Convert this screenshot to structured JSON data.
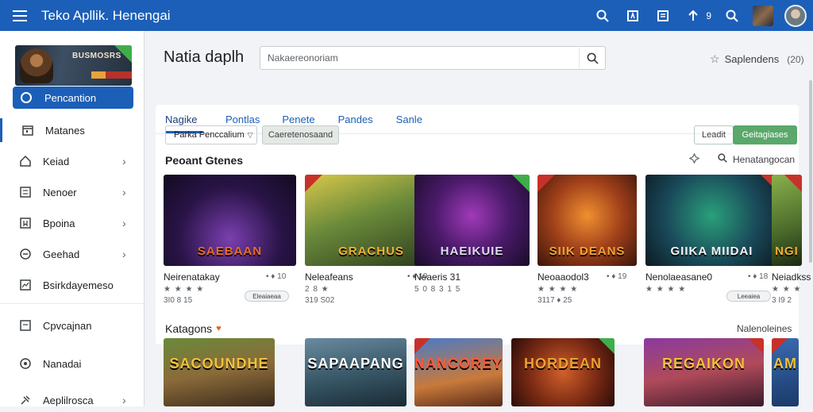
{
  "topbar": {
    "title": "Teko Apllik. Henengai",
    "count": "9",
    "icons": [
      "menu-icon",
      "search-icon",
      "store-icon",
      "news-icon",
      "upload-icon",
      "search-icon-2"
    ]
  },
  "sidebar": {
    "promo": {
      "text": "BUSMOSRS"
    },
    "primary": {
      "label": "Pencantion"
    },
    "items": [
      {
        "label": "Matanes",
        "icon": "calendar-icon",
        "chevron": false,
        "active": true
      },
      {
        "label": "Keiad",
        "icon": "home-icon",
        "chevron": true
      },
      {
        "label": "Nenoer",
        "icon": "image-icon",
        "chevron": true
      },
      {
        "label": "Bpoina",
        "icon": "bookmark-icon",
        "chevron": true
      },
      {
        "label": "Geehad",
        "icon": "compass-icon",
        "chevron": true
      },
      {
        "label": "Bsirkdayemeso",
        "icon": "chart-icon",
        "chevron": false
      },
      {
        "label": "Cpvcajnan",
        "icon": "document-icon",
        "chevron": false
      },
      {
        "label": "Nanadai",
        "icon": "pin-icon",
        "chevron": false
      },
      {
        "label": "Aeplilrosca",
        "icon": "puzzle-icon",
        "chevron": true
      }
    ]
  },
  "main": {
    "title": "Natia daplh",
    "search": {
      "placeholder": "Nakaereonoriam"
    },
    "favorites": {
      "label": "Saplendens",
      "count": "(20)"
    },
    "tabs": [
      "Nagike",
      "Pontlas",
      "Penete",
      "Pandes",
      "Sanle"
    ],
    "filter": {
      "select": "Parka Penccalium",
      "chip": "Caeretenosaand"
    },
    "actions": {
      "ghost": "Leadit",
      "primary": "Geitagiases"
    },
    "section": {
      "title": "Peoant Gtenes",
      "link": "Henatangocan"
    },
    "games": [
      {
        "title": "SAEBAAN",
        "name": "Neirenatakay",
        "meta": "• ♦ 10",
        "stars": "★ ★ ★ ★",
        "price": "3I0 8 15",
        "pill": "Eleaiaeaa",
        "accent": "#e86a24",
        "ribbon": ""
      },
      {
        "title": "GRACHUS",
        "name": "Neleafeans",
        "meta": "• ♦ 10",
        "stars": "2 8 ★",
        "price": "319 S02",
        "pill": "",
        "accent": "#f0b030",
        "ribbon": "#c8312a"
      },
      {
        "title": "HAEIKUIE",
        "name": "Neaeris 31",
        "meta": "",
        "stars": "5 0 8  3 1 5",
        "price": "",
        "pill": "",
        "accent": "#e0d8f0",
        "ribbon": "#3fae4a"
      },
      {
        "title": "SIIK DEANS",
        "name": "Neoaaodol3",
        "meta": "• ♦ 19",
        "stars": "★ ★ ★ ★",
        "price": "3117 ♦ 25",
        "pill": "",
        "accent": "#f2a133",
        "ribbon": "#c8312a"
      },
      {
        "title": "GIIKA MIIDAI",
        "name": "Nenolaeasane0",
        "meta": "• ♦ 18",
        "stars": "★ ★ ★ ★",
        "price": "",
        "pill": "Leeaiea",
        "accent": "#f4f4f4",
        "ribbon": "#c8312a"
      },
      {
        "title": "NGI",
        "name": "Neiadkss",
        "meta": "",
        "stars": "★ ★ ★",
        "price": "3 I9  2",
        "pill": "",
        "accent": "#f0b030",
        "ribbon": "#c8312a"
      }
    ],
    "section2": {
      "title": "Katagons",
      "link": "Nalenoleines"
    },
    "games2": [
      {
        "title": "SACOUNDHE",
        "accent": "#f2c23a",
        "ribbon": ""
      },
      {
        "title": "SAPAAPANG",
        "accent": "#ffffff",
        "ribbon": ""
      },
      {
        "title": "NANCOREY",
        "accent": "#ff5a3a",
        "ribbon": "#c8312a"
      },
      {
        "title": "HORDEAN",
        "accent": "#f0a030",
        "ribbon": "#3fae4a"
      },
      {
        "title": "REGAIKON",
        "accent": "#f2c23a",
        "ribbon": "#c8312a"
      },
      {
        "title": "AM",
        "accent": "#f2c23a",
        "ribbon": "#c8312a"
      }
    ]
  }
}
